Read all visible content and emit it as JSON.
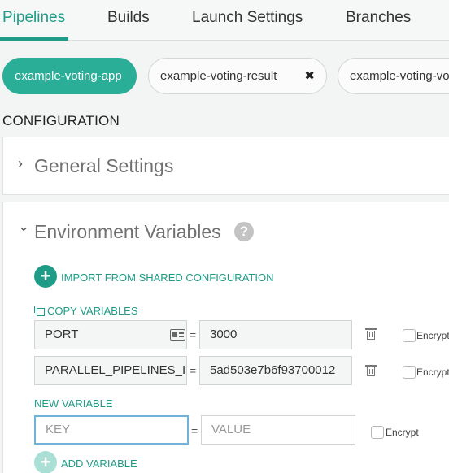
{
  "tabs": [
    {
      "label": "Pipelines",
      "active": true
    },
    {
      "label": "Builds",
      "active": false
    },
    {
      "label": "Launch Settings",
      "active": false
    },
    {
      "label": "Branches",
      "active": false
    }
  ],
  "pipelines": [
    {
      "label": "example-voting-app",
      "active": true
    },
    {
      "label": "example-voting-result",
      "active": false,
      "close_glyph": "✖"
    },
    {
      "label": "example-voting-vote",
      "active": false
    }
  ],
  "section_title": "CONFIGURATION",
  "general_settings": {
    "title": "General Settings",
    "chevron": "›"
  },
  "env_vars": {
    "title": "Environment Variables",
    "chevron": "⌄",
    "help_glyph": "?",
    "import_label": "IMPORT FROM SHARED CONFIGURATION",
    "copy_label": "COPY VARIABLES",
    "rows": [
      {
        "key": "PORT",
        "eq": "=",
        "value": "3000",
        "encrypt_label": "Encrypt"
      },
      {
        "key": "PARALLEL_PIPELINES_I",
        "eq": "=",
        "value": "5ad503e7b6f93700012",
        "encrypt_label": "Encrypt"
      }
    ],
    "new_variable_label": "NEW VARIABLE",
    "new_key_placeholder": "KEY",
    "new_eq": "=",
    "new_value_placeholder": "VALUE",
    "new_encrypt_label": "Encrypt",
    "add_label": "ADD VARIABLE"
  },
  "colors": {
    "accent": "#1e9c87",
    "chip_active": "#2aae97",
    "focus": "#6fb4d8"
  }
}
